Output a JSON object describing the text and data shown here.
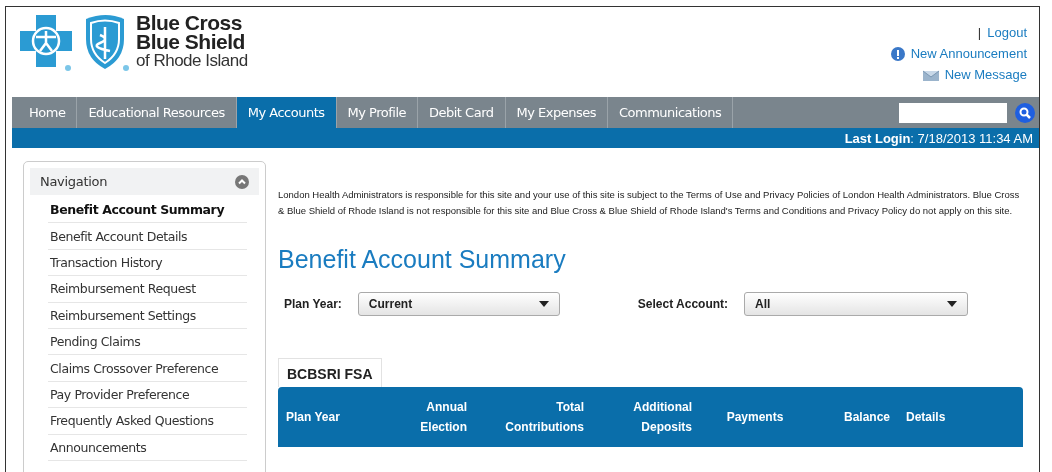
{
  "logo": {
    "lines": [
      "Blue Cross",
      "Blue Shield",
      "of Rhode Island"
    ]
  },
  "header_links": {
    "separator": "|",
    "logout": "Logout",
    "announcement": "New Announcement",
    "message": "New Message"
  },
  "tabs": [
    {
      "label": "Home",
      "selected": false
    },
    {
      "label": "Educational Resources",
      "selected": false
    },
    {
      "label": "My Accounts",
      "selected": true
    },
    {
      "label": "My Profile",
      "selected": false
    },
    {
      "label": "Debit Card",
      "selected": false
    },
    {
      "label": "My Expenses",
      "selected": false
    },
    {
      "label": "Communications",
      "selected": false
    }
  ],
  "last_login": "**Last Login**: 7/18/2013 11:34 AM",
  "sidebar": {
    "title": "Navigation",
    "expanded": true,
    "items": [
      {
        "label": "Benefit Account Summary",
        "selected": true
      },
      {
        "label": "Benefit Account Details",
        "selected": false
      },
      {
        "label": "Transaction History",
        "selected": false
      },
      {
        "label": "Reimbursement Request",
        "selected": false
      },
      {
        "label": "Reimbursement Settings",
        "selected": false
      },
      {
        "label": "Pending Claims",
        "selected": false
      },
      {
        "label": "Claims Crossover Preference",
        "selected": false
      },
      {
        "label": "Pay Provider Preference",
        "selected": false
      },
      {
        "label": "Frequently Asked Questions",
        "selected": false
      },
      {
        "label": "Announcements",
        "selected": false
      }
    ]
  },
  "disclaimer": "London Health Administrators is responsible for this site and your use of this site is subject to the Terms of Use and Privacy Policies of London Health Administrators. Blue Cross & Blue Shield of Rhode Island is not responsible for this site and Blue Cross & Blue Shield of Rhode Island's Terms and Conditions and Privacy Policy do not apply on this site.",
  "page_title": "Benefit Account Summary",
  "filters": [
    {
      "label": "Plan Year:",
      "value": "Current"
    },
    {
      "label": "Select Account:",
      "value": "All"
    }
  ],
  "account_tab": "BCBSRI FSA",
  "table": {
    "columns": [
      "Plan Year",
      "Annual Election",
      "Total Contributions",
      "Additional Deposits",
      "Payments",
      "Balance",
      "Details"
    ]
  }
}
